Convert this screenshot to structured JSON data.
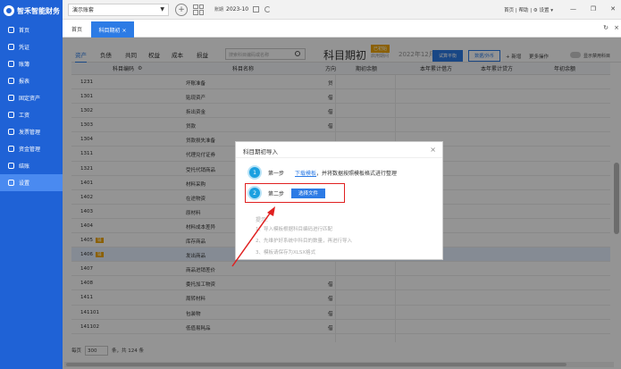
{
  "app": {
    "logo_text": "智禾智能财务"
  },
  "sidebar": {
    "items": [
      {
        "label": "首页",
        "active": false
      },
      {
        "label": "凭证",
        "active": false
      },
      {
        "label": "账簿",
        "active": false
      },
      {
        "label": "报表",
        "active": false
      },
      {
        "label": "固定资产",
        "active": false
      },
      {
        "label": "工资",
        "active": false
      },
      {
        "label": "发票管理",
        "active": false
      },
      {
        "label": "资金管理",
        "active": false
      },
      {
        "label": "结账",
        "active": false
      },
      {
        "label": "设置",
        "active": true
      }
    ]
  },
  "topbar": {
    "account": "演示账套",
    "period_label": "账期",
    "period_value": "2023-10",
    "links": "首页 | 帮助 | ⚙ 设置 ▾"
  },
  "tabs": {
    "home": "首页",
    "active": "科目期初 ×"
  },
  "content": {
    "categories": [
      "资产",
      "负债",
      "共同",
      "权益",
      "成本",
      "损益"
    ],
    "search_placeholder": "搜索科目编码或名称",
    "title": "科目期初",
    "init_badge": "已初始",
    "period_small": "启用期间",
    "period_big": "2022年12月",
    "btn_trial_balance": "试算平衡",
    "btn_import_export": "数据/外币",
    "act_add": "+ 新增",
    "act_more": "更多操作",
    "act_show_disabled": "显示禁用科目",
    "headers": {
      "code": "科目编码",
      "name": "科目名称",
      "direction": "方向",
      "opening": "期初余额",
      "debit": "本年累计借方",
      "credit": "本年累计贷方",
      "year_balance": "年初余额"
    },
    "rows": [
      {
        "code": "1231",
        "name": "坏账准备",
        "dir": "贷",
        "tag": ""
      },
      {
        "code": "1301",
        "name": "贴现资产",
        "dir": "借",
        "tag": ""
      },
      {
        "code": "1302",
        "name": "拆出资金",
        "dir": "借",
        "tag": ""
      },
      {
        "code": "1303",
        "name": "贷款",
        "dir": "借",
        "tag": ""
      },
      {
        "code": "1304",
        "name": "贷款损失准备",
        "dir": "",
        "tag": ""
      },
      {
        "code": "1311",
        "name": "代理兑付证券",
        "dir": "",
        "tag": ""
      },
      {
        "code": "1321",
        "name": "受托代销商品",
        "dir": "",
        "tag": ""
      },
      {
        "code": "1401",
        "name": "材料采购",
        "dir": "",
        "tag": ""
      },
      {
        "code": "1402",
        "name": "在途物资",
        "dir": "",
        "tag": ""
      },
      {
        "code": "1403",
        "name": "原材料",
        "dir": "",
        "tag": ""
      },
      {
        "code": "1404",
        "name": "材料成本差异",
        "dir": "",
        "tag": ""
      },
      {
        "code": "1405",
        "name": "库存商品",
        "dir": "",
        "tag": "辅"
      },
      {
        "code": "1406",
        "name": "发出商品",
        "dir": "",
        "tag": "辅"
      },
      {
        "code": "1407",
        "name": "商品进销差价",
        "dir": "",
        "tag": ""
      },
      {
        "code": "1408",
        "name": "委托加工物资",
        "dir": "借",
        "tag": ""
      },
      {
        "code": "1411",
        "name": "周转材料",
        "dir": "借",
        "tag": ""
      },
      {
        "code": "141101",
        "name": "包装物",
        "dir": "借",
        "tag": ""
      },
      {
        "code": "141102",
        "name": "低值易耗品",
        "dir": "借",
        "tag": ""
      }
    ],
    "footer": {
      "per_page_label": "每页",
      "per_page": "300",
      "total": "条，共 124 条"
    }
  },
  "modal": {
    "title": "科目期初导入",
    "step1_label": "第一步",
    "step1_link": "下载模板",
    "step1_text": "，并将数据按照模板格式进行整理",
    "step2_label": "第二步",
    "step2_button": "选择文件",
    "tips_label": "提示:",
    "tips": [
      "1、导入模板根据科目编码进行匹配",
      "2、先维护好系统中科目的数量，再进行导入",
      "3、模板请保存为XLSX格式"
    ]
  },
  "colors": {
    "primary": "#2c7be5",
    "sidebar": "#1f62d6",
    "badge": "#f0a500",
    "highlight": "#e02020"
  }
}
